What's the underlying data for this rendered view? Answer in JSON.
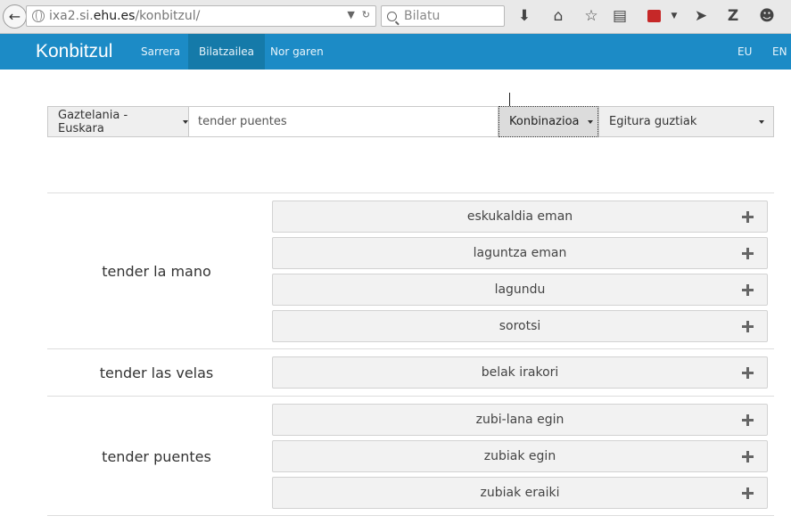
{
  "browser": {
    "url_prefix": "ixa2.si.",
    "url_host": "ehu.es",
    "url_path": "/konbitzul/",
    "search_placeholder": "Bilatu"
  },
  "navbar": {
    "brand": "Konbitzul",
    "items": [
      {
        "label": "Sarrera",
        "active": false
      },
      {
        "label": "Bilatzailea",
        "active": true
      },
      {
        "label": "Nor garen",
        "active": false
      }
    ],
    "languages": [
      "EU",
      "EN"
    ]
  },
  "search": {
    "language_pair": "Gaztelania - Euskara",
    "query": "tender puentes",
    "combination_button": "Konbinazioa",
    "structure": "Egitura guztiak"
  },
  "results": [
    {
      "term": "tender la mano",
      "translations": [
        "eskukaldia eman",
        "laguntza eman",
        "lagundu",
        "sorotsi"
      ]
    },
    {
      "term": "tender las velas",
      "translations": [
        "belak irakori"
      ]
    },
    {
      "term": "tender puentes",
      "translations": [
        "zubi-lana egin",
        "zubiak egin",
        "zubiak eraiki"
      ]
    }
  ],
  "icons": {
    "back": "back-arrow-icon",
    "site": "globe-icon",
    "reload": "reload-icon",
    "search": "search-icon",
    "download": "download-icon",
    "home": "home-icon",
    "bookmark": "star-icon",
    "reader": "clipboard-icon",
    "extension": "extension-icon",
    "send": "send-icon",
    "zotero": "z-icon",
    "emoji": "smiley-icon",
    "expand": "plus-icon"
  },
  "colors": {
    "navbar": "#1c8bc6",
    "navbar_active": "#157aa9",
    "brand_text": "#ffffff"
  }
}
